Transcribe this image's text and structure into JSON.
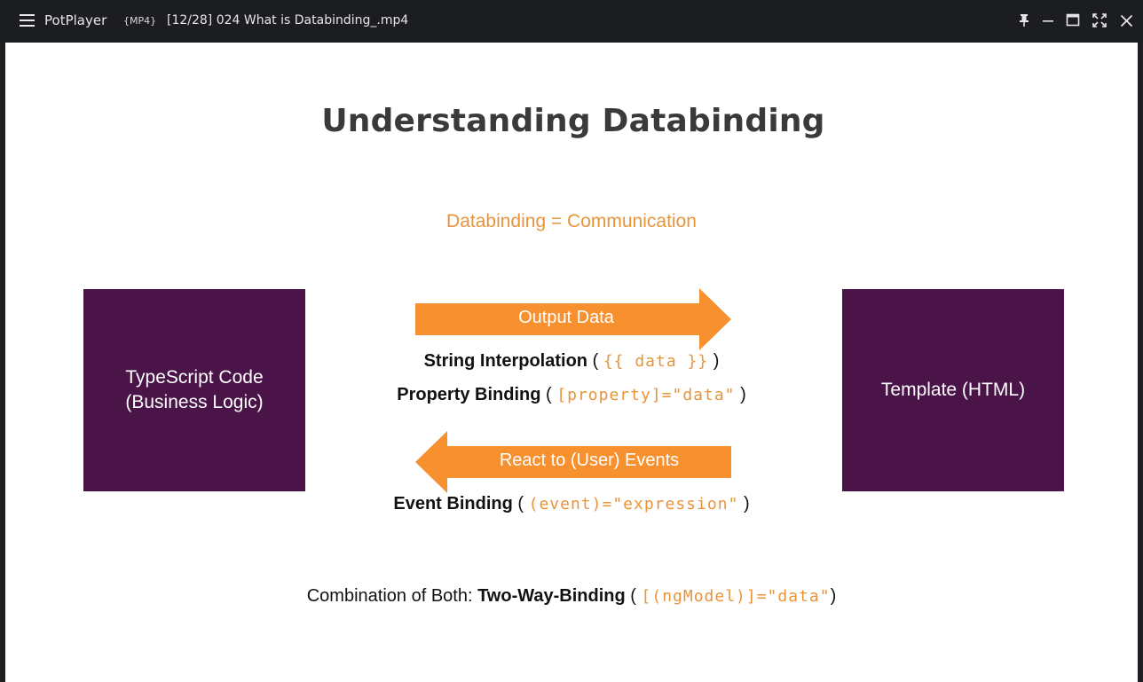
{
  "window": {
    "app_name": "PotPlayer",
    "format_badge": "{MP4}",
    "file_name": "[12/28] 024 What is Databinding_.mp4",
    "controls": [
      "pin-icon",
      "minimize-icon",
      "maximize-icon",
      "fullscreen-icon",
      "close-icon"
    ]
  },
  "slide": {
    "title": "Understanding Databinding",
    "subtitle": "Databinding = Communication",
    "left_box": {
      "line1": "TypeScript Code",
      "line2": "(Business Logic)"
    },
    "right_box": {
      "line1": "Template (HTML)"
    },
    "output_arrow": {
      "label": "Output Data"
    },
    "events_arrow": {
      "label": "React to (User) Events"
    },
    "string_interpolation": {
      "name": "String Interpolation",
      "open": "(",
      "code": "{{ data }}",
      "close": ")"
    },
    "property_binding": {
      "name": "Property Binding",
      "open": "(",
      "code": "[property]=\"data\"",
      "close": ")"
    },
    "event_binding": {
      "name": "Event Binding",
      "open": "(",
      "code": "(event)=\"expression\"",
      "close": ")"
    },
    "two_way": {
      "prefix": "Combination of Both:",
      "name": "Two-Way-Binding",
      "open": "(",
      "code": "[(ngModel)]=\"data\"",
      "close": ")"
    }
  },
  "colors": {
    "accent_orange": "#f7902f",
    "box_purple": "#4a1448",
    "title_gray": "#3a3a3a",
    "code_orange": "#e8943a"
  }
}
